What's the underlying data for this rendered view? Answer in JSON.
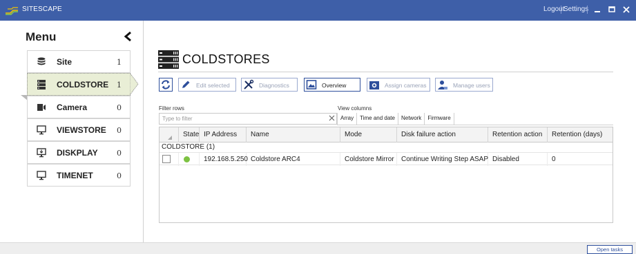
{
  "app": {
    "title": "SITESCAPE",
    "logout_label": "Logout",
    "settings_label": "Settings",
    "accent_color": "#3e5fa8"
  },
  "sidebar": {
    "menu_title": "Menu",
    "items": [
      {
        "label": "Site",
        "count": "1",
        "icon": "database-icon"
      },
      {
        "label": "COLDSTORE",
        "count": "1",
        "icon": "server-rack-icon",
        "active": true
      },
      {
        "label": "Camera",
        "count": "0",
        "icon": "video-camera-icon"
      },
      {
        "label": "VIEWSTORE",
        "count": "0",
        "icon": "monitor-icon"
      },
      {
        "label": "DISKPLAY",
        "count": "0",
        "icon": "display-download-icon"
      },
      {
        "label": "TIMENET",
        "count": "0",
        "icon": "monitor-icon"
      }
    ]
  },
  "main": {
    "page_title": "COLDSTORES",
    "toolbar": {
      "refresh_icon": "refresh-icon",
      "edit_selected": "Edit selected",
      "diagnostics": "Diagnostics",
      "overview": "Overview",
      "assign_cameras": "Assign cameras",
      "manage_users": "Manage users"
    },
    "filter": {
      "label": "Filter rows",
      "placeholder": "Type to filter"
    },
    "view_columns": {
      "label": "View columns",
      "tabs": [
        "Array",
        "Time and date",
        "Network",
        "Firmware"
      ]
    },
    "table": {
      "columns": [
        "State",
        "IP Address",
        "Name",
        "Mode",
        "Disk failure action",
        "Retention action",
        "Retention (days)"
      ],
      "group_label": "COLDSTORE (1)",
      "rows": [
        {
          "state_color": "#7dc242",
          "ip": "192.168.5.250",
          "name": "Coldstore ARC4",
          "mode": "Coldstore Mirror",
          "disk_failure_action": "Continue Writing Step ASAP",
          "retention_action": "Disabled",
          "retention_days": "0"
        }
      ]
    }
  },
  "statusbar": {
    "open_tasks": "Open tasks"
  }
}
